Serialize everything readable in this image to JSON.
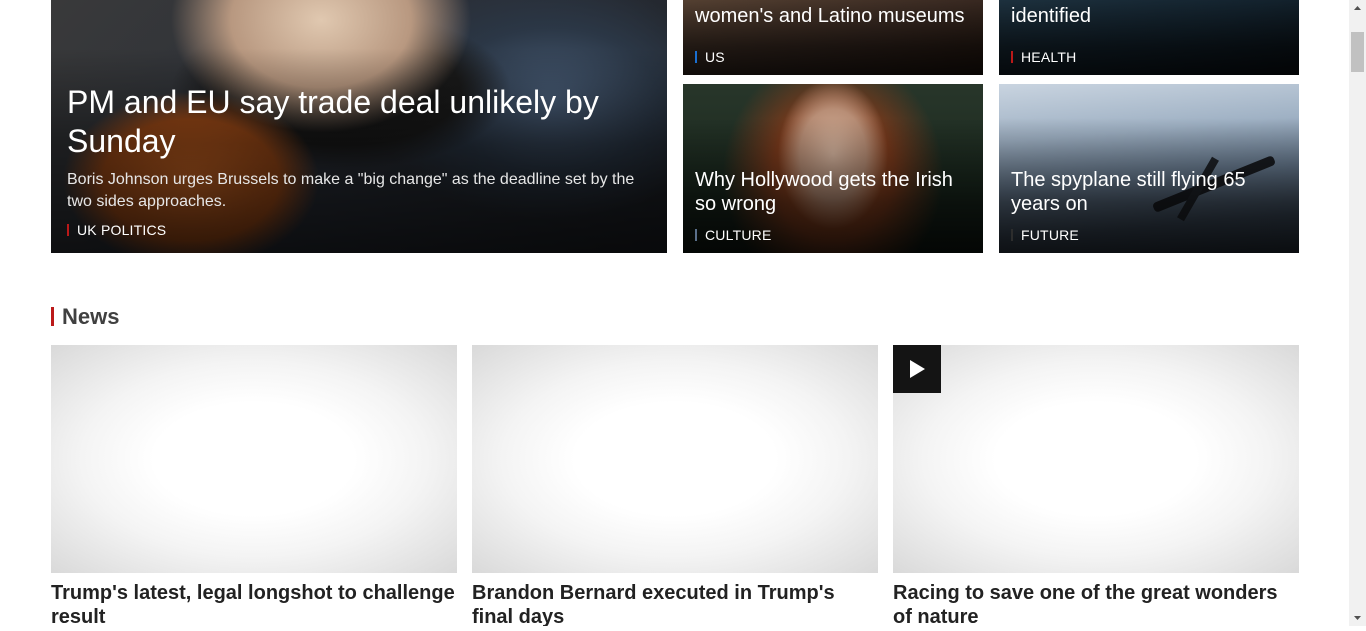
{
  "colors": {
    "section_accent": "#bb1919",
    "tag_uk_politics": "#bb1919",
    "tag_us": "#1a6fd1",
    "tag_health": "#bb1919",
    "tag_culture": "#5a6f8a",
    "tag_future": "#2d2d2d"
  },
  "top_stories": {
    "hero": {
      "headline": "PM and EU say trade deal unlikely by Sunday",
      "summary": "Boris Johnson urges Brussels to make a \"big change\" as the deadline set by the two sides approaches.",
      "tag": "UK POLITICS"
    },
    "us": {
      "headline": "Lone US senator blocks women's and Latino museums",
      "tag": "US"
    },
    "health": {
      "headline": "Genetic clues for severe Covid identified",
      "tag": "HEALTH"
    },
    "culture": {
      "headline": "Why Hollywood gets the Irish so wrong",
      "tag": "CULTURE"
    },
    "future": {
      "headline": "The spyplane still flying 65 years on",
      "tag": "FUTURE"
    }
  },
  "news": {
    "section_title": "News",
    "items": [
      {
        "title": "Trump's latest, legal longshot to challenge result",
        "has_video": false
      },
      {
        "title": "Brandon Bernard executed in Trump's final days",
        "has_video": false
      },
      {
        "title": "Racing to save one of the great wonders of nature",
        "has_video": true,
        "video_icon": "play-icon"
      }
    ]
  },
  "scrollbar": {
    "icons": [
      "scroll-up-arrow-icon",
      "scroll-down-arrow-icon"
    ]
  }
}
